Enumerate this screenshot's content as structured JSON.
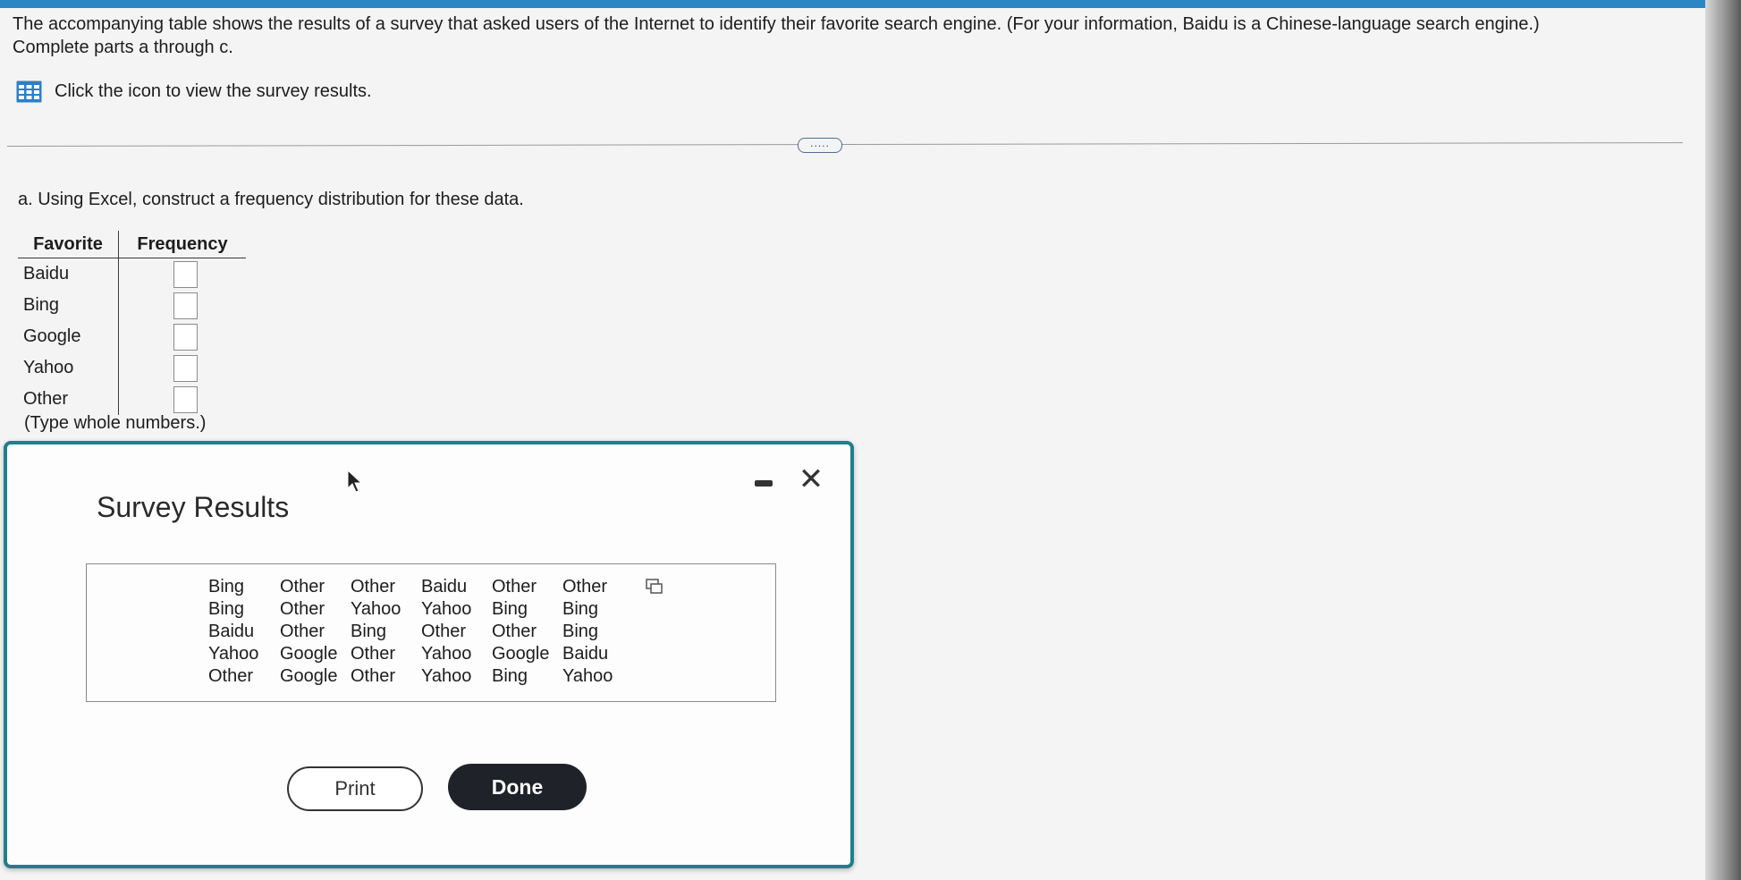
{
  "intro": {
    "line1": "The accompanying table shows the results of a survey that asked users of the Internet to identify their favorite search engine. (For your information, Baidu is a Chinese-language search engine.)",
    "line2": "Complete parts a through c.",
    "link_text": "Click the icon to view the survey results."
  },
  "part_a": {
    "instruction": "a. Using Excel, construct a frequency distribution for these data.",
    "headers": {
      "favorite": "Favorite",
      "frequency": "Frequency"
    },
    "rows": [
      {
        "label": "Baidu",
        "value": ""
      },
      {
        "label": "Bing",
        "value": ""
      },
      {
        "label": "Google",
        "value": ""
      },
      {
        "label": "Yahoo",
        "value": ""
      },
      {
        "label": "Other",
        "value": ""
      }
    ],
    "note": "(Type whole numbers.)"
  },
  "more_button": {
    "label": "....."
  },
  "dialog": {
    "title": "Survey Results",
    "data_rows": [
      [
        "Bing",
        "Other",
        "Other",
        "Baidu",
        "Other",
        "Other"
      ],
      [
        "Bing",
        "Other",
        "Yahoo",
        "Yahoo",
        "Bing",
        "Bing"
      ],
      [
        "Baidu",
        "Other",
        "Bing",
        "Other",
        "Other",
        "Bing"
      ],
      [
        "Yahoo",
        "Google",
        "Other",
        "Yahoo",
        "Google",
        "Baidu"
      ],
      [
        "Other",
        "Google",
        "Other",
        "Yahoo",
        "Bing",
        "Yahoo"
      ]
    ],
    "print_label": "Print",
    "done_label": "Done",
    "close_glyph": "✕"
  },
  "colors": {
    "accent": "#1f7f8a",
    "topbar": "#2b87c4",
    "done_bg": "#1f2329"
  },
  "icons": [
    "table-grid-icon",
    "copy-icon",
    "minimize-icon",
    "close-icon",
    "mouse-cursor-icon"
  ]
}
